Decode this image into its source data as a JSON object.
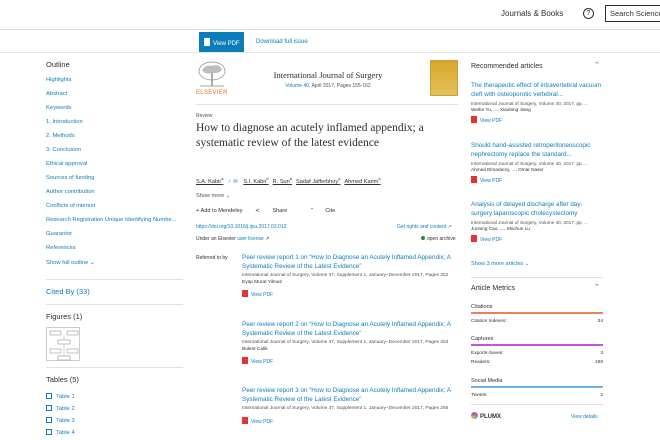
{
  "header": {
    "journals_books": "Journals & Books",
    "help_glyph": "?",
    "search_placeholder": "Search ScienceDirect"
  },
  "toolbar": {
    "view_pdf": "View PDF",
    "download_issue": "Download full issue"
  },
  "outline": {
    "title": "Outline",
    "items": [
      "Highlights",
      "Abstract",
      "Keywords",
      "1. Introduction",
      "2. Methods",
      "3. Conclusion",
      "Ethical approval",
      "Sources of funding",
      "Author contribution",
      "Conflicts of interest",
      "Research Registration Unique Identifying Numbe...",
      "Guarantor",
      "References"
    ],
    "show_full": "Show full outline"
  },
  "cited_by": "Cited By (33)",
  "figures": {
    "title": "Figures (1)"
  },
  "tables": {
    "title": "Tables (5)",
    "items": [
      "Table 1",
      "Table 2",
      "Table 3",
      "Table 4"
    ]
  },
  "journal": {
    "publisher": "ELSEVIER",
    "title": "International Journal of Surgery",
    "volume_link": "Volume 40",
    "volume_rest": ", April 2017, Pages 155-162"
  },
  "article": {
    "type": "Review",
    "title": "How to diagnose an acutely inflamed appendix; a systematic review of the latest evidence",
    "authors": [
      {
        "name": "S.A. Kabir",
        "sup": "a"
      },
      {
        "name": "S.I. Kabir",
        "sup": "b"
      },
      {
        "name": "R. Sun",
        "sup": "a"
      },
      {
        "name": "Sadaf Jafferbhoy",
        "sup": "a"
      },
      {
        "name": "Ahmed Karim",
        "sup": "a"
      }
    ],
    "show_more": "Show more",
    "actions": {
      "add": "+ Add to Mendeley",
      "share": "Share",
      "cite": "Cite"
    },
    "doi": "https://doi.org/10.1016/j.ijsu.2017.03.013",
    "rights": "Get rights and content",
    "license_prefix": "Under an Elsevier",
    "license_link": "user license",
    "open_archive": "open archive",
    "referred_by": "Referred to by"
  },
  "peer_reviews": [
    {
      "title": "Peer review report 1 on “How to Diagnose an Acutely Inflamed Appendix; A Systematic Review of the Latest Evidence”",
      "source": "International Journal of Surgery, Volume 37, Supplement 1, January–December 2017, Pages 252",
      "author": "Eyüp Murat Yilmaz",
      "pdf": "View PDF"
    },
    {
      "title": "Peer review report 2 on “How to Diagnose an Acutely Inflamed Appendix; A Systematic Review of the Latest Evidence”",
      "source": "International Journal of Surgery, Volume 37, Supplement 1, January–December 2017, Pages 253",
      "author": "Bulent Calik",
      "pdf": "View PDF"
    },
    {
      "title": "Peer review report 3 on “How to Diagnose an Acutely Inflamed Appendix; A Systematic Review of the Latest Evidence”",
      "source": "International Journal of Surgery, Volume 37, Supplement 1, January–December 2017, Pages 266",
      "author": "",
      "pdf": "View PDF"
    }
  ],
  "recommended": {
    "title": "Recommended articles",
    "items": [
      {
        "title": "The therapeutic effect of intravertebral vacuum cleft with osteoporotic vertebral...",
        "source": "International Journal of Surgery, Volume 40, 2017, pp. ...",
        "authors": "Weibo Yu, ..., Xiaobing Jiang",
        "pdf": "View PDF"
      },
      {
        "title": "Should hand-assisted retroperitoneoscopic nephrectomy replace the standard...",
        "source": "International Journal of Surgery, Volume 40, 2017, pp. ...",
        "authors": "Ahmed Elmaraezy, ..., Omar Naser",
        "pdf": "View PDF"
      },
      {
        "title": "Analysis of delayed discharge after day-surgery laparoscopic cholecystectomy",
        "source": "International Journal of Surgery, Volume 40, 2017, pp. ...",
        "authors": "Junning Cao, ..., Shichun Lu",
        "pdf": "View PDF"
      }
    ],
    "show_more": "Show 3 more articles"
  },
  "metrics": {
    "title": "Article Metrics",
    "citations_label": "Citations",
    "citation_indexes_label": "Citation Indexes:",
    "citation_indexes": "34",
    "captures_label": "Captures",
    "exports_label": "Exports-Saves:",
    "exports": "3",
    "readers_label": "Readers:",
    "readers": "198",
    "social_label": "Social Media",
    "tweets_label": "Tweets:",
    "tweets": "2",
    "plumx": "PLUMX",
    "view_details": "View details"
  },
  "colors": {
    "link": "#0c7dbb",
    "citations_bar": "#e8825a",
    "captures_bar": "#c056d6",
    "social_bar": "#6cb2e8"
  }
}
